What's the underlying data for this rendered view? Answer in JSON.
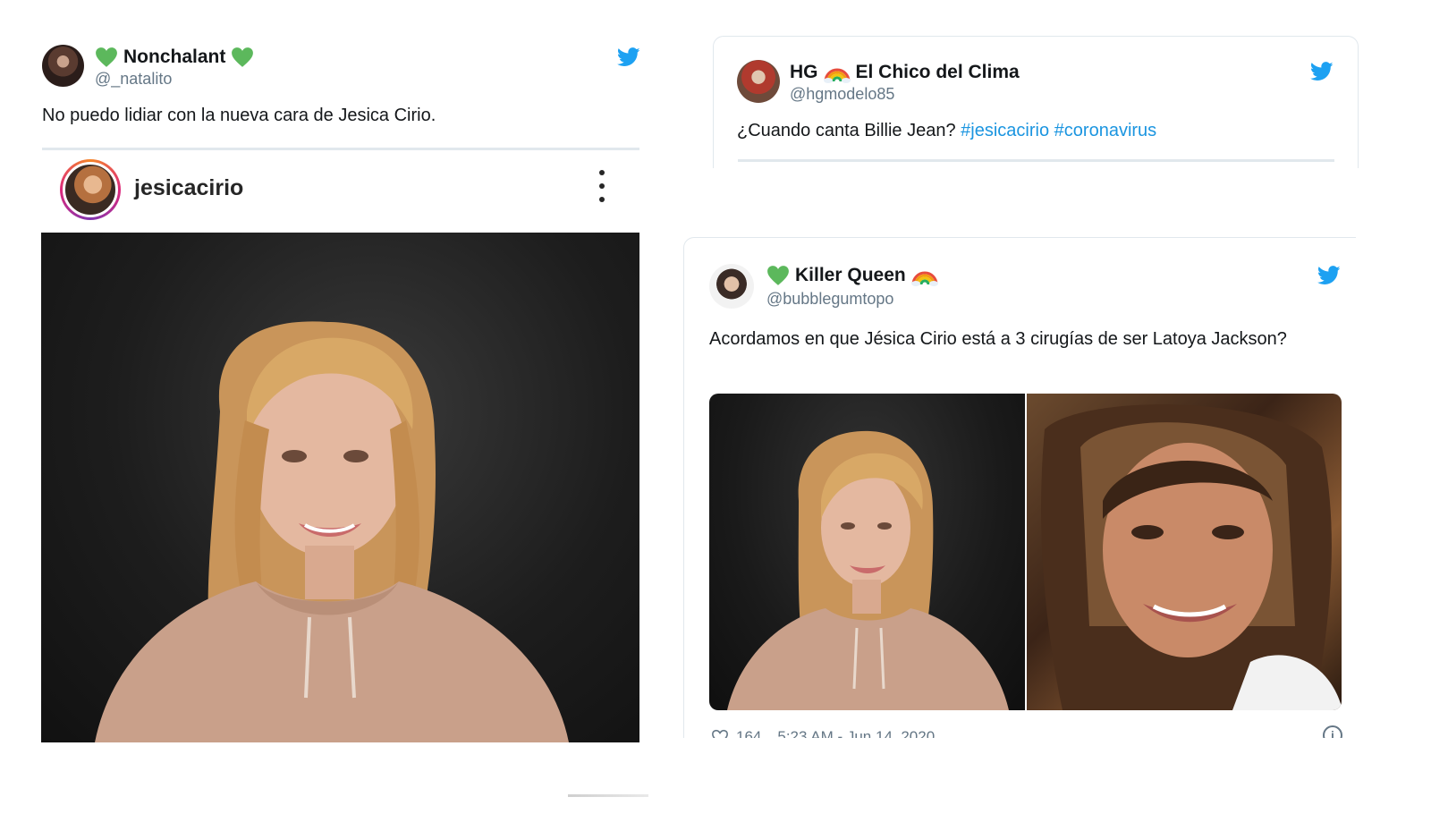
{
  "tweets": [
    {
      "display_name": "Nonchalant",
      "handle": "@_natalito",
      "text": "No puedo lidiar con la nueva cara de Jesica Cirio.",
      "embedded_post": {
        "username": "jesicacirio"
      }
    },
    {
      "display_name_prefix": "HG",
      "display_name": "El Chico del Clima",
      "handle": "@hgmodelo85",
      "text": "¿Cuando canta Billie Jean?",
      "hashtags": [
        "#jesicacirio",
        "#coronavirus"
      ]
    },
    {
      "display_name": "Killer Queen",
      "handle": "@bubblegumtopo",
      "text": "Acordamos en que Jésica Cirio está a 3 cirugías de ser Latoya Jackson?",
      "likes": "164",
      "timestamp": "5:23 AM - Jun 14, 2020"
    }
  ],
  "colors": {
    "twitter_blue": "#1da1f2",
    "hashtag": "#1b95e0",
    "heart_green": "#5cb85c",
    "handle_gray": "#657786"
  },
  "icons": [
    "twitter-bird-icon",
    "green-heart-emoji",
    "rainbow-emoji",
    "more-vertical-icon",
    "like-heart-icon",
    "info-icon"
  ]
}
